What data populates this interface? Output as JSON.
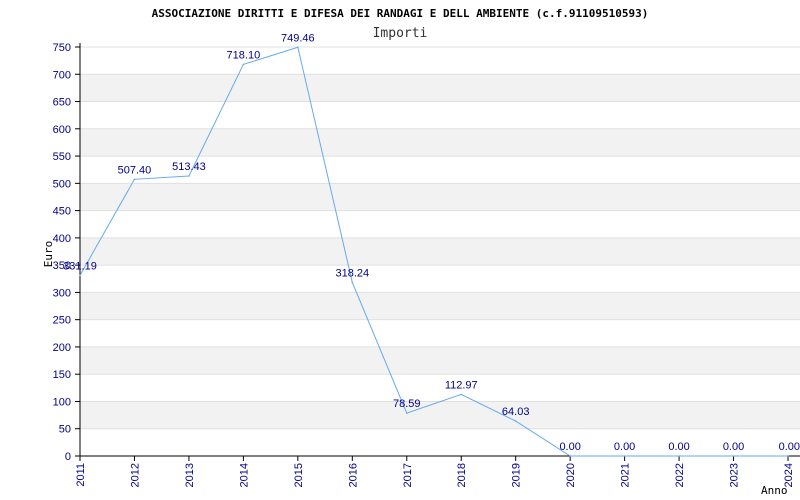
{
  "chart_data": {
    "type": "line",
    "title": "ASSOCIAZIONE DIRITTI E DIFESA DEI RANDAGI E DELL AMBIENTE (c.f.91109510593)",
    "subtitle": "Importi",
    "xlabel": "Anno",
    "ylabel": "Euro",
    "x": [
      "2011",
      "2012",
      "2013",
      "2014",
      "2015",
      "2016",
      "2017",
      "2018",
      "2019",
      "2020",
      "2021",
      "2022",
      "2023",
      "2024"
    ],
    "series": [
      {
        "values": [
          331.19,
          507.4,
          513.43,
          718.1,
          749.46,
          318.24,
          78.59,
          112.97,
          64.03,
          0.0,
          0.0,
          0.0,
          0.0,
          0.0
        ],
        "point_labels": [
          "331.19",
          "507.40",
          "513.43",
          "718.10",
          "749.46",
          "318.24",
          "78.59",
          "112.97",
          "64.03",
          "0.00",
          "0.00",
          "0.00",
          "0.00",
          "0.00"
        ],
        "color": "#66aaee"
      }
    ],
    "ylim": [
      0,
      750
    ],
    "yticks": [
      "0",
      "50",
      "100",
      "150",
      "200",
      "250",
      "300",
      "350",
      "400",
      "450",
      "500",
      "550",
      "600",
      "650",
      "700",
      "750"
    ],
    "grid": "horizontal alternating bands",
    "colors": {
      "band": "#f2f2f2",
      "grid": "#e0e0e0",
      "axis": "#000000",
      "tick_text": "#00008b",
      "line": "#66aaee"
    }
  }
}
